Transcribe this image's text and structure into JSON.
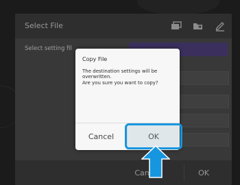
{
  "screen": {
    "title": "Select File",
    "setting_label": "Select setting fil",
    "footer": {
      "cancel_label": "Cancel",
      "ok_label": "OK"
    },
    "icons": [
      "folder-copy-icon",
      "folder-move-icon",
      "edit-icon"
    ]
  },
  "dialog": {
    "title": "Copy File",
    "message": "The destination settings will be overwritten.\nAre you sure you want to copy?",
    "cancel_label": "Cancel",
    "ok_label": "OK"
  },
  "annotation": {
    "highlight_color": "#1796e0",
    "target": "ok-button"
  }
}
